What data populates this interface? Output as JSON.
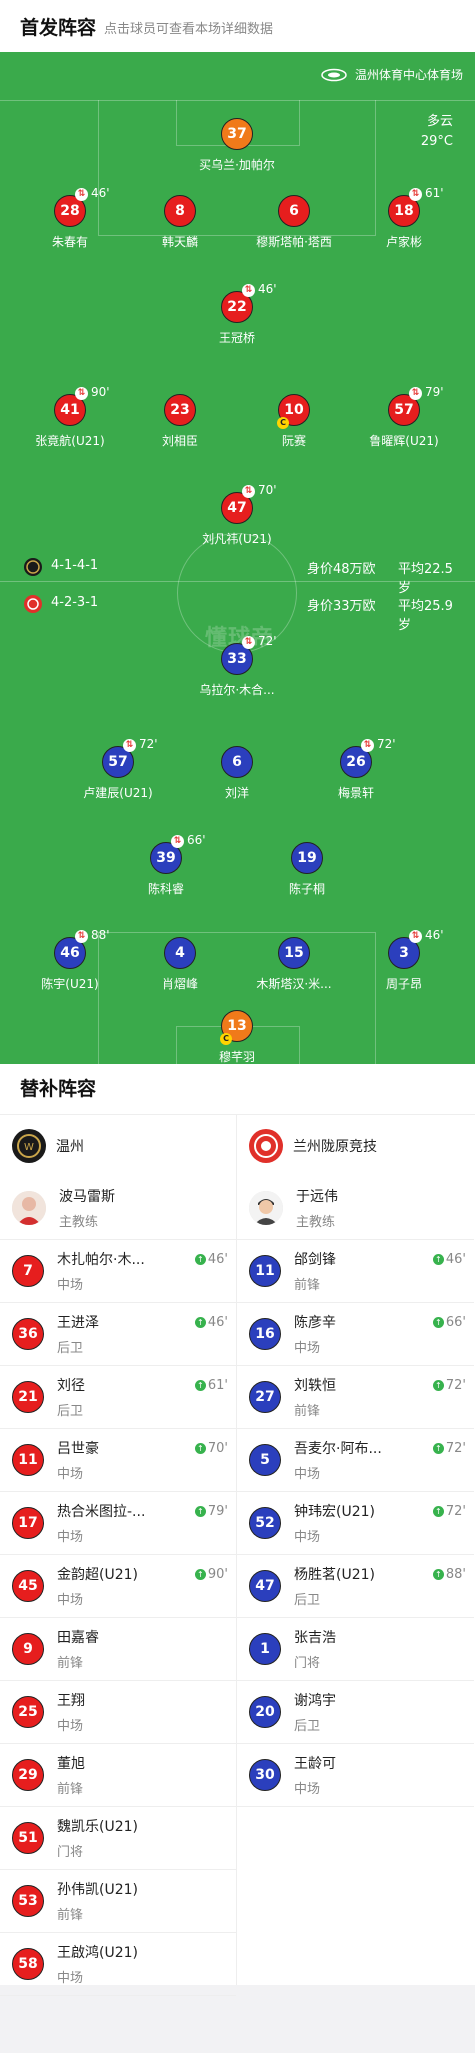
{
  "header": {
    "title": "首发阵容",
    "subtitle": "点击球员可查看本场详细数据"
  },
  "venue": "温州体育中心体育场",
  "weather": {
    "condition": "多云",
    "temp": "29°C"
  },
  "watermark": "懂球帝",
  "home_formation": {
    "formation": "4-1-4-1",
    "value": "身价48万欧",
    "age": "平均22.5岁",
    "color": "#1a1a1a"
  },
  "away_formation": {
    "formation": "4-2-3-1",
    "value": "身价33万欧",
    "age": "平均25.9岁",
    "color": "#e0302a"
  },
  "colors": {
    "home": "#e61e1e",
    "away": "#2b3fbd",
    "keeper": "#f07a1a",
    "pitch": "#3aaa4b",
    "sub_in": "#37b24d"
  },
  "home_lineup": [
    {
      "num": "37",
      "name": "买乌兰·加帕尔",
      "kit": "orange"
    },
    {
      "num": "28",
      "name": "朱春有",
      "kit": "red",
      "sub": "46'"
    },
    {
      "num": "8",
      "name": "韩天麟",
      "kit": "red"
    },
    {
      "num": "6",
      "name": "穆斯塔帕·塔西",
      "kit": "red"
    },
    {
      "num": "18",
      "name": "卢家彬",
      "kit": "red",
      "sub": "61'"
    },
    {
      "num": "22",
      "name": "王冠桥",
      "kit": "red",
      "sub": "46'"
    },
    {
      "num": "41",
      "name": "张竟航(U21)",
      "kit": "red",
      "sub": "90'"
    },
    {
      "num": "23",
      "name": "刘相臣",
      "kit": "red"
    },
    {
      "num": "10",
      "name": "阮赛",
      "kit": "red",
      "yellow": true
    },
    {
      "num": "57",
      "name": "鲁曜辉(U21)",
      "kit": "red",
      "sub": "79'"
    },
    {
      "num": "47",
      "name": "刘凡祎(U21)",
      "kit": "red",
      "sub": "70'"
    }
  ],
  "away_lineup": [
    {
      "num": "33",
      "name": "乌拉尔·木合...",
      "kit": "blue",
      "sub": "72'"
    },
    {
      "num": "57",
      "name": "卢建辰(U21)",
      "kit": "blue",
      "sub": "72'"
    },
    {
      "num": "6",
      "name": "刘洋",
      "kit": "blue"
    },
    {
      "num": "26",
      "name": "梅景轩",
      "kit": "blue",
      "sub": "72'"
    },
    {
      "num": "39",
      "name": "陈科睿",
      "kit": "blue",
      "sub": "66'"
    },
    {
      "num": "19",
      "name": "陈子桐",
      "kit": "blue"
    },
    {
      "num": "46",
      "name": "陈宇(U21)",
      "kit": "blue",
      "sub": "88'"
    },
    {
      "num": "4",
      "name": "肖熠峰",
      "kit": "blue"
    },
    {
      "num": "15",
      "name": "木斯塔汉·米...",
      "kit": "blue"
    },
    {
      "num": "3",
      "name": "周子昂",
      "kit": "blue",
      "sub": "46'"
    },
    {
      "num": "13",
      "name": "穆芊羽",
      "kit": "orange",
      "yellow": true
    }
  ],
  "bench_title": "替补阵容",
  "home_bench": {
    "team": "温州",
    "coach": {
      "name": "波马雷斯",
      "role": "主教练"
    },
    "players": [
      {
        "num": "7",
        "name": "木扎帕尔·木...",
        "pos": "中场",
        "min": "46'"
      },
      {
        "num": "36",
        "name": "王进泽",
        "pos": "后卫",
        "min": "46'"
      },
      {
        "num": "21",
        "name": "刘径",
        "pos": "后卫",
        "min": "61'"
      },
      {
        "num": "11",
        "name": "吕世豪",
        "pos": "中场",
        "min": "70'"
      },
      {
        "num": "17",
        "name": "热合米图拉-...",
        "pos": "中场",
        "min": "79'"
      },
      {
        "num": "45",
        "name": "金韵超(U21)",
        "pos": "中场",
        "min": "90'"
      },
      {
        "num": "9",
        "name": "田嘉睿",
        "pos": "前锋"
      },
      {
        "num": "25",
        "name": "王翔",
        "pos": "中场"
      },
      {
        "num": "29",
        "name": "董旭",
        "pos": "前锋"
      },
      {
        "num": "51",
        "name": "魏凯乐(U21)",
        "pos": "门将"
      },
      {
        "num": "53",
        "name": "孙伟凯(U21)",
        "pos": "前锋"
      },
      {
        "num": "58",
        "name": "王啟鸿(U21)",
        "pos": "中场"
      }
    ]
  },
  "away_bench": {
    "team": "兰州陇原竞技",
    "coach": {
      "name": "于远伟",
      "role": "主教练"
    },
    "players": [
      {
        "num": "11",
        "name": "邰剑锋",
        "pos": "前锋",
        "min": "46'"
      },
      {
        "num": "16",
        "name": "陈彦辛",
        "pos": "中场",
        "min": "66'"
      },
      {
        "num": "27",
        "name": "刘轶恒",
        "pos": "前锋",
        "min": "72'"
      },
      {
        "num": "5",
        "name": "吾麦尔·阿布...",
        "pos": "中场",
        "min": "72'"
      },
      {
        "num": "52",
        "name": "钟玮宏(U21)",
        "pos": "中场",
        "min": "72'"
      },
      {
        "num": "47",
        "name": "杨胜茗(U21)",
        "pos": "后卫",
        "min": "88'"
      },
      {
        "num": "1",
        "name": "张吉浩",
        "pos": "门将"
      },
      {
        "num": "20",
        "name": "谢鸿宇",
        "pos": "后卫"
      },
      {
        "num": "30",
        "name": "王龄可",
        "pos": "中场"
      }
    ]
  }
}
